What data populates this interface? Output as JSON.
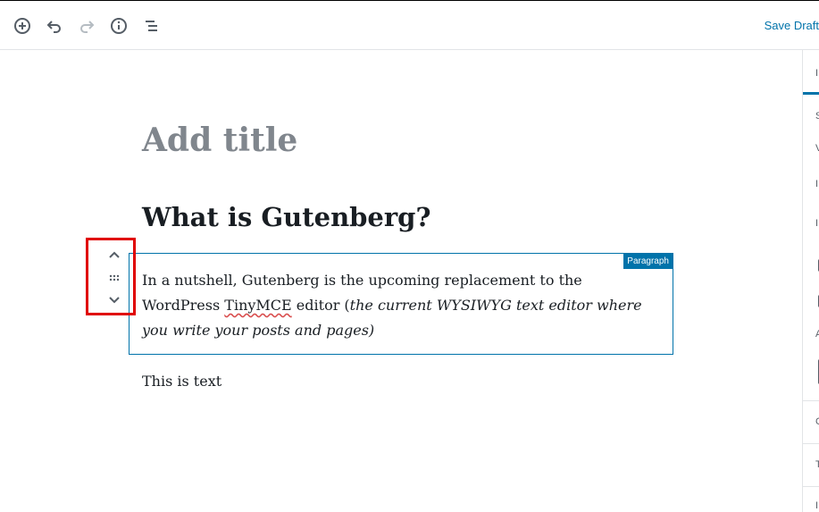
{
  "toolbar": {
    "add_block_icon": "plus-circle",
    "undo_icon": "undo-arrow",
    "redo_icon": "redo-arrow",
    "info_icon": "info-circle",
    "outline_icon": "list-outline",
    "save_draft_label": "Save Draft"
  },
  "editor": {
    "title_placeholder": "Add title",
    "heading": "What is Gutenberg?",
    "paragraph": {
      "text_plain_1": "In a nutshell, Gutenberg is the upcoming replacement to the WordPress ",
      "text_spell": "TinyMCE",
      "text_plain_2": " editor (",
      "text_italic": "the current WYSIWYG text editor where you write your posts and pages)",
      "block_type_label": "Paragraph"
    },
    "second_paragraph": "This is text"
  },
  "block_mover": {
    "up_icon": "chevron-up",
    "drag_icon": "drag-handle",
    "down_icon": "chevron-down",
    "highlight_color": "#e00000"
  },
  "colors": {
    "accent": "#0073aa",
    "title_placeholder": "#80868d",
    "text": "#191e23"
  }
}
